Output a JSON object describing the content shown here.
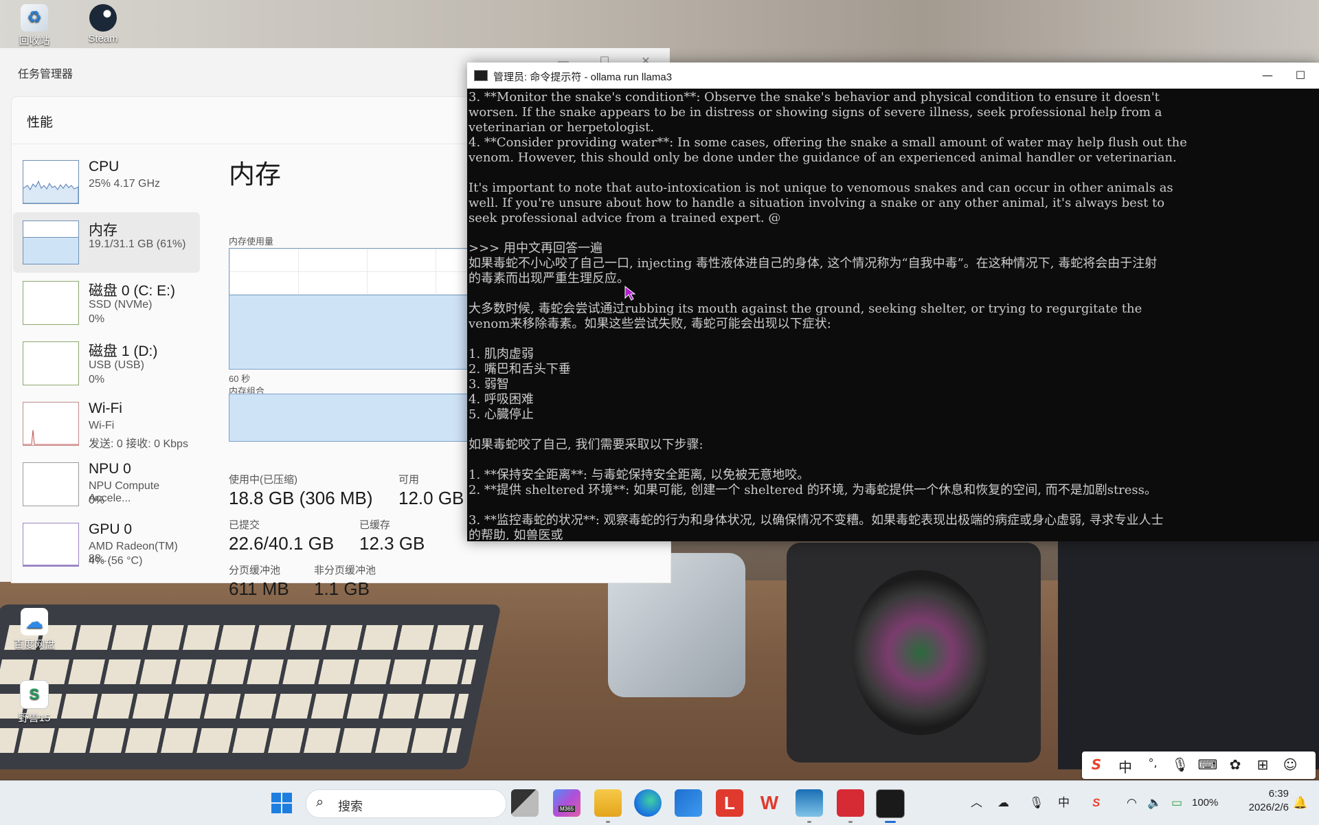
{
  "desktop": {
    "icons": [
      {
        "label": "回收站"
      },
      {
        "label": "Steam"
      },
      {
        "label": "百度网盘"
      },
      {
        "label": "野兽15"
      }
    ]
  },
  "task_manager": {
    "window_title": "任务管理器",
    "section_header": "性能",
    "sidebar": [
      {
        "name": "CPU",
        "line2": "25%  4.17 GHz",
        "line3": ""
      },
      {
        "name": "内存",
        "line2": "19.1/31.1 GB (61%)",
        "line3": ""
      },
      {
        "name": "磁盘 0 (C: E:)",
        "line2": "SSD (NVMe)",
        "line3": "0%"
      },
      {
        "name": "磁盘 1 (D:)",
        "line2": "USB (USB)",
        "line3": "0%"
      },
      {
        "name": "Wi-Fi",
        "line2": "Wi-Fi",
        "line3": "发送: 0  接收: 0 Kbps"
      },
      {
        "name": "NPU 0",
        "line2": "NPU Compute Accele...",
        "line3": "0%"
      },
      {
        "name": "GPU 0",
        "line2": "AMD Radeon(TM) 88...",
        "line3": "4% (56 °C)"
      }
    ],
    "detail": {
      "title": "内存",
      "usage_label": "内存使用量",
      "time_label": "60 秒",
      "composition_label": "内存组合",
      "usage_fill_fraction": 0.61,
      "stats": {
        "in_use_label": "使用中(已压缩)",
        "in_use_value": "18.8 GB (306 MB)",
        "available_label": "可用",
        "available_value": "12.0 GB",
        "committed_label": "已提交",
        "committed_value": "22.6/40.1 GB",
        "cached_label": "已缓存",
        "cached_value": "12.3 GB",
        "paged_label": "分页缓冲池",
        "paged_value": "611 MB",
        "nonpaged_label": "非分页缓冲池",
        "nonpaged_value": "1.1 GB"
      }
    }
  },
  "cmd": {
    "title": "管理员: 命令提示符 - ollama  run llama3",
    "lines": [
      "3. **Monitor the snake's condition**: Observe the snake's behavior and physical condition to ensure it doesn't",
      "worsen. If the snake appears to be in distress or showing signs of severe illness, seek professional help from a",
      "veterinarian or herpetologist.",
      "4. **Consider providing water**: In some cases, offering the snake a small amount of water may help flush out the",
      "venom. However, this should only be done under the guidance of an experienced animal handler or veterinarian.",
      "",
      "It's important to note that auto-intoxication is not unique to venomous snakes and can occur in other animals as",
      "well. If you're unsure about how to handle a situation involving a snake or any other animal, it's always best to",
      "seek professional advice from a trained expert. @",
      "",
      ">>> 用中文再回答一遍",
      "如果毒蛇不小心咬了自己一口, injecting 毒性液体进自己的身体, 这个情况称为“自我中毒”。在这种情况下, 毒蛇将会由于注射",
      "的毒素而出现严重生理反应。",
      "",
      "大多数时候, 毒蛇会尝试通过rubbing its mouth against the ground, seeking shelter, or trying to regurgitate the",
      "venom来移除毒素。如果这些尝试失败, 毒蛇可能会出现以下症状:",
      "",
      "1. 肌肉虚弱",
      "2. 嘴巴和舌头下垂",
      "3. 弱智",
      "4. 呼吸困难",
      "5. 心臓停止",
      "",
      "如果毒蛇咬了自己, 我们需要采取以下步骤:",
      "",
      "1. **保持安全距离**: 与毒蛇保持安全距离, 以免被无意地咬。",
      "2. **提供 sheltered 环境**: 如果可能, 创建一个 sheltered 的环境, 为毒蛇提供一个休息和恢复的空间, 而不是加剧stress。",
      "",
      "3. **监控毒蛇的状况**: 观察毒蛇的行为和身体状况, 以确保情况不变糟。如果毒蛇表现出极端的病症或身心虚弱, 寻求专业人士",
      "的帮助, 如兽医或"
    ]
  },
  "ime": {
    "logo": "S",
    "mode": "中",
    "punct": "°,"
  },
  "taskbar": {
    "search_placeholder": "搜索",
    "m365_badge": "M365",
    "ime_indicator": "中",
    "battery": "100%",
    "time": "6:39",
    "date": "2026/2/6"
  }
}
